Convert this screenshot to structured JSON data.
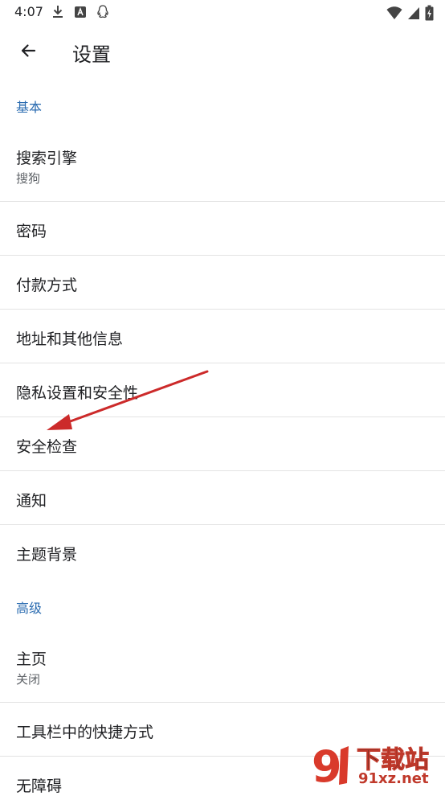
{
  "status_bar": {
    "time": "4:07",
    "icons": [
      "download-icon",
      "font-a-icon",
      "qq-penguin-icon",
      "wifi-icon",
      "signal-icon",
      "battery-charging-icon"
    ]
  },
  "app_bar": {
    "back_icon": "arrow-back-icon",
    "title": "设置"
  },
  "sections": {
    "basic": {
      "header": "基本",
      "items": [
        {
          "title": "搜索引擎",
          "summary": "搜狗"
        },
        {
          "title": "密码"
        },
        {
          "title": "付款方式"
        },
        {
          "title": "地址和其他信息"
        },
        {
          "title": "隐私设置和安全性"
        },
        {
          "title": "安全检查"
        },
        {
          "title": "通知"
        },
        {
          "title": "主题背景"
        }
      ]
    },
    "advanced": {
      "header": "高级",
      "items": [
        {
          "title": "主页",
          "summary": "关闭"
        },
        {
          "title": "工具栏中的快捷方式"
        },
        {
          "title": "无障碍"
        }
      ]
    }
  },
  "annotation": {
    "arrow_color": "#cc2a2a"
  },
  "watermark": {
    "logo_number": "9",
    "text_top": "下载站",
    "text_bottom": "91xz.net"
  }
}
